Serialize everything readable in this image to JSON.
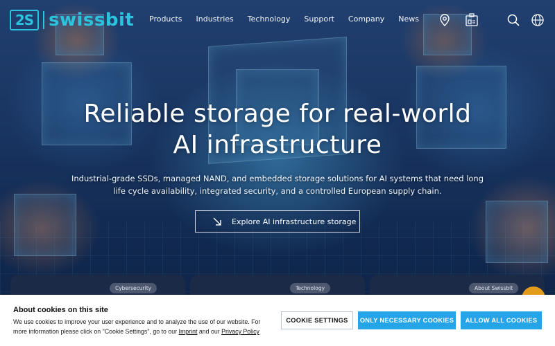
{
  "header": {
    "logo_mark": "2S",
    "logo_text": "swissbit",
    "nav": [
      "Products",
      "Industries",
      "Technology",
      "Support",
      "Company",
      "News"
    ],
    "icons": [
      "location-pin-icon",
      "contact-card-icon",
      "search-icon",
      "globe-icon"
    ]
  },
  "hero": {
    "title": "Reliable storage for real-world AI infrastructure",
    "subtitle": "Industrial-grade SSDs, managed NAND, and embedded storage solutions for AI systems that need long life cycle availability, integrated security, and a controlled European supply chain.",
    "cta_label": "Explore AI infrastructure storage"
  },
  "cards": [
    {
      "tag": "Cybersecurity"
    },
    {
      "tag": "Technology"
    },
    {
      "tag": "About Swissbit"
    }
  ],
  "cookie": {
    "title": "About cookies on this site",
    "text_before": "We use cookies to improve your user experience and to analyze the use of our website. For more information please click on \"Cookie Settings\", go to our ",
    "imprint_link": "Imprint",
    "text_mid": " and our ",
    "privacy_link": "Privacy Policy",
    "settings_label": "COOKIE SETTINGS",
    "necessary_label": "ONLY NECESSARY COOKIES",
    "allow_label": "ALLOW ALL COOKIES"
  },
  "colors": {
    "brand": "#2dc3df",
    "accent_button": "#25a5e8",
    "help_button": "#e39b1b",
    "card_bg": "#1b2a47"
  }
}
